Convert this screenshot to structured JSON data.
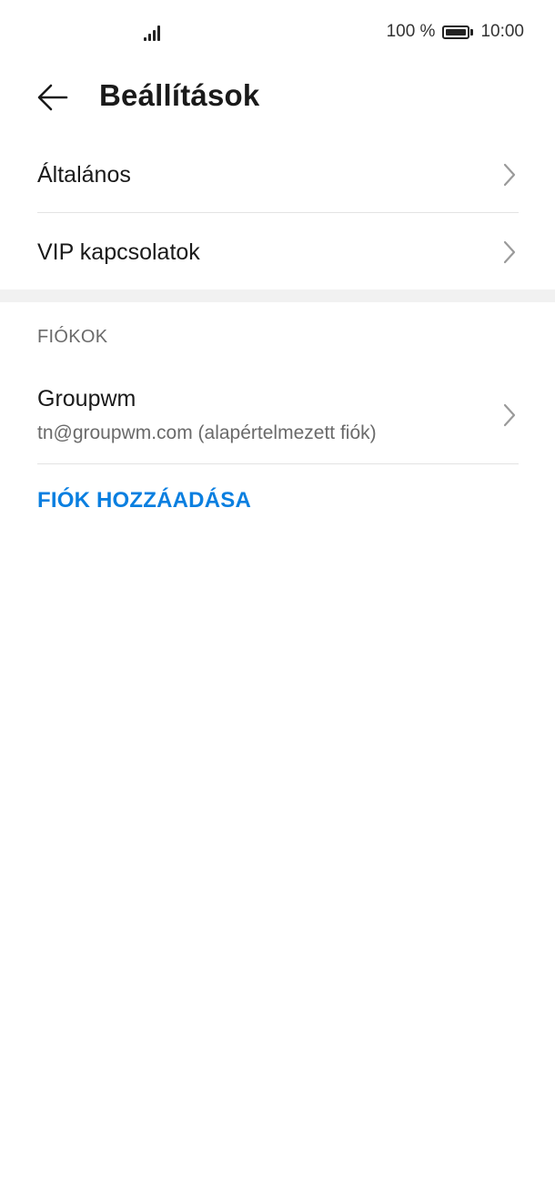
{
  "status_bar": {
    "battery_text": "100 %",
    "time": "10:00",
    "signal_icon": "signal-icon",
    "battery_icon": "battery-icon"
  },
  "header": {
    "title": "Beállítások",
    "back_icon": "arrow-left-icon"
  },
  "settings": {
    "items": [
      {
        "label": "Általános"
      },
      {
        "label": "VIP kapcsolatok"
      }
    ]
  },
  "accounts": {
    "section_title": "FIÓKOK",
    "items": [
      {
        "name": "Groupwm",
        "email": "tn@groupwm.com (alapértelmezett fiók)"
      }
    ],
    "add_label": "FIÓK HOZZÁADÁSA"
  },
  "colors": {
    "accent": "#0a7fe0",
    "section_gap": "#f1f1f1",
    "divider": "#e3e3e3"
  }
}
